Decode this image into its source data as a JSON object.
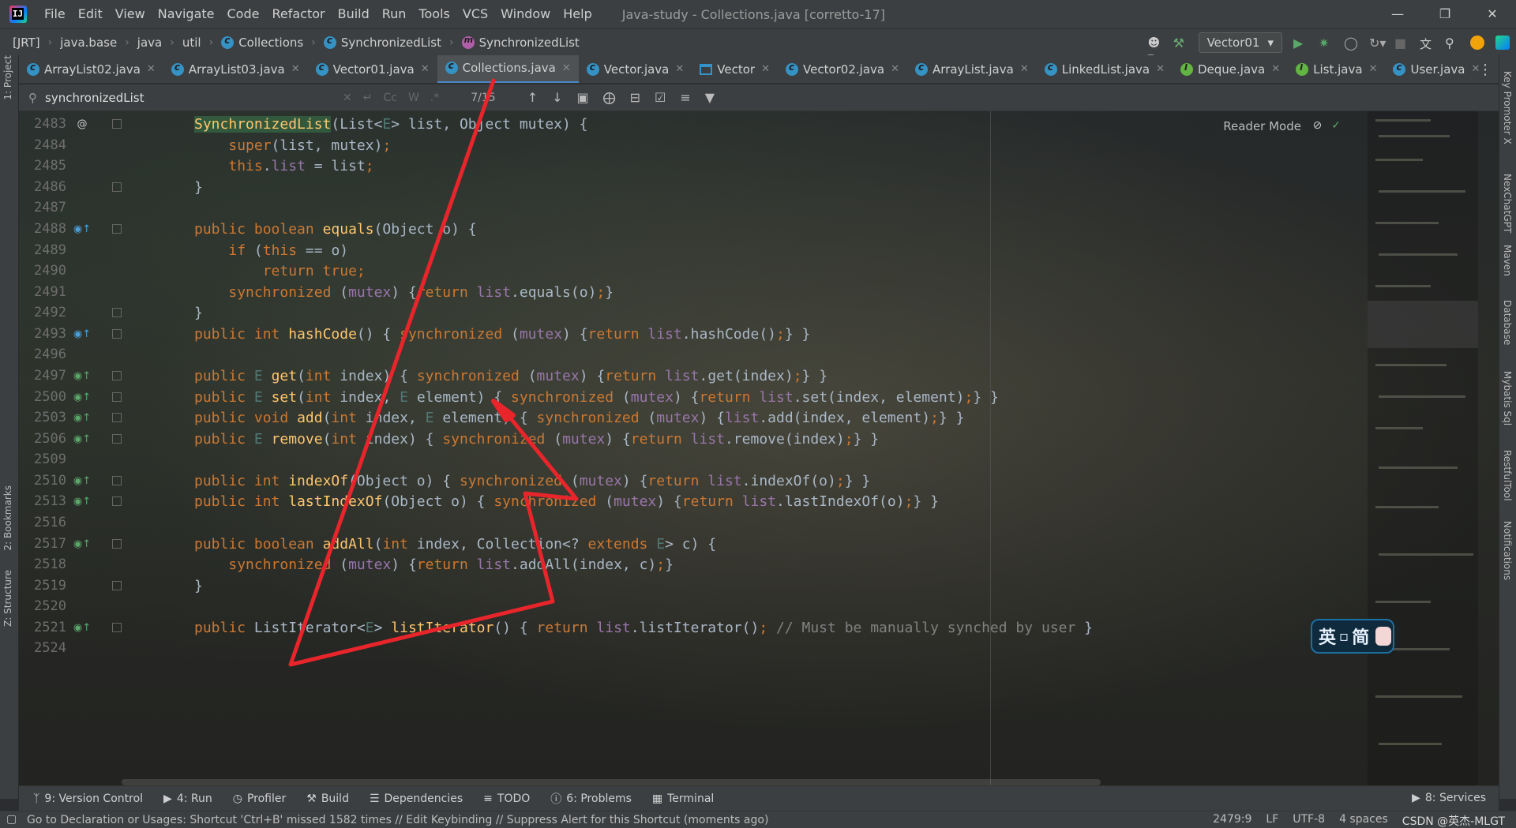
{
  "menu": {
    "items": [
      "File",
      "Edit",
      "View",
      "Navigate",
      "Code",
      "Refactor",
      "Build",
      "Run",
      "Tools",
      "VCS",
      "Window",
      "Help"
    ],
    "window_title": "Java-study - Collections.java [corretto-17]"
  },
  "breadcrumbs": [
    "[JRT]",
    "java.base",
    "java",
    "util",
    "Collections",
    "SynchronizedList",
    "SynchronizedList"
  ],
  "run_config": "Vector01",
  "tabs": [
    {
      "label": "ArrayList02.java",
      "icon": "class-icon",
      "active": false
    },
    {
      "label": "ArrayList03.java",
      "icon": "class-icon",
      "active": false
    },
    {
      "label": "Vector01.java",
      "icon": "class-icon",
      "active": false
    },
    {
      "label": "Collections.java",
      "icon": "class-icon",
      "active": true
    },
    {
      "label": "Vector.java",
      "icon": "class-icon",
      "active": false
    },
    {
      "label": "Vector",
      "icon": "structure-icon",
      "active": false
    },
    {
      "label": "Vector02.java",
      "icon": "class-icon",
      "active": false
    },
    {
      "label": "ArrayList.java",
      "icon": "class-icon",
      "active": false
    },
    {
      "label": "LinkedList.java",
      "icon": "class-icon",
      "active": false
    },
    {
      "label": "Deque.java",
      "icon": "interface-icon",
      "active": false
    },
    {
      "label": "List.java",
      "icon": "interface-icon",
      "active": false
    },
    {
      "label": "User.java",
      "icon": "class-icon",
      "active": false
    }
  ],
  "find": {
    "query": "synchronizedList",
    "count": "7/15",
    "opt_case": "Cc",
    "opt_words": "W"
  },
  "editor": {
    "reader_mode": "Reader Mode",
    "lines": [
      {
        "n": "2483",
        "mark": "@"
      },
      {
        "n": "2484",
        "mark": ""
      },
      {
        "n": "2485",
        "mark": ""
      },
      {
        "n": "2486",
        "mark": ""
      },
      {
        "n": "2487",
        "mark": ""
      },
      {
        "n": "2488",
        "mark": "override"
      },
      {
        "n": "2489",
        "mark": ""
      },
      {
        "n": "2490",
        "mark": ""
      },
      {
        "n": "2491",
        "mark": ""
      },
      {
        "n": "2492",
        "mark": ""
      },
      {
        "n": "2493",
        "mark": "override"
      },
      {
        "n": "2496",
        "mark": ""
      },
      {
        "n": "2497",
        "mark": "implements"
      },
      {
        "n": "2500",
        "mark": "implements"
      },
      {
        "n": "2503",
        "mark": "implements"
      },
      {
        "n": "2506",
        "mark": "implements"
      },
      {
        "n": "2509",
        "mark": ""
      },
      {
        "n": "2510",
        "mark": "implements"
      },
      {
        "n": "2513",
        "mark": "implements"
      },
      {
        "n": "2516",
        "mark": ""
      },
      {
        "n": "2517",
        "mark": "implements"
      },
      {
        "n": "2518",
        "mark": ""
      },
      {
        "n": "2519",
        "mark": ""
      },
      {
        "n": "2520",
        "mark": ""
      },
      {
        "n": "2521",
        "mark": "implements"
      },
      {
        "n": "2524",
        "mark": ""
      }
    ]
  },
  "left_tools": [
    "1: Project",
    "2: Bookmarks",
    "Z: Structure"
  ],
  "right_tools": [
    "Key Promoter X",
    "NexChatGPT",
    "Maven",
    "Database",
    "Mybatis Sql",
    "RestfulTool",
    "Notifications"
  ],
  "bottom_tools": [
    "9: Version Control",
    "4: Run",
    "Profiler",
    "Build",
    "Dependencies",
    "TODO",
    "6: Problems",
    "Terminal"
  ],
  "bottom_right_tool": "8: Services",
  "ime": "英\u0000简",
  "status": {
    "message": "Go to Declaration or Usages: Shortcut 'Ctrl+B' missed 1582 times // Edit Keybinding // Suppress Alert for this Shortcut (moments ago)",
    "position": "2479:9",
    "line_sep": "LF",
    "encoding": "UTF-8",
    "indent": "4 spaces",
    "watermark": "CSDN @英杰-MLGT"
  },
  "colors": {
    "accent": "#4a88c7",
    "annotation_arrow": "#e8252b",
    "keyword": "#cc7832",
    "function": "#ffc66d",
    "field": "#9876aa"
  }
}
